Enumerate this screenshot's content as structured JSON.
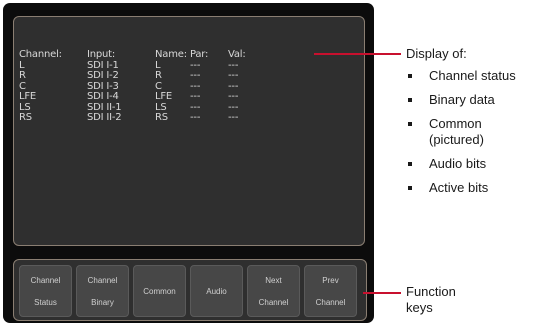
{
  "display": {
    "headers": [
      "Channel:",
      "Input:",
      "Name:",
      "Par:",
      "Val:"
    ],
    "rows": [
      [
        "L",
        "SDI I-1",
        "L",
        "---",
        "---"
      ],
      [
        "R",
        "SDI I-2",
        "R",
        "---",
        "---"
      ],
      [
        "C",
        "SDI I-3",
        "C",
        "---",
        "---"
      ],
      [
        "LFE",
        "SDI I-4",
        "LFE",
        "---",
        "---"
      ],
      [
        "LS",
        "SDI II-1",
        "LS",
        "---",
        "---"
      ],
      [
        "RS",
        "SDI II-2",
        "RS",
        "---",
        "---"
      ]
    ]
  },
  "function_keys": [
    {
      "line1": "Channel",
      "line2": "Status"
    },
    {
      "line1": "Channel",
      "line2": "Binary"
    },
    {
      "line1": "Common",
      "line2": ""
    },
    {
      "line1": "Audio",
      "line2": ""
    },
    {
      "line1": "Next",
      "line2": "Channel"
    },
    {
      "line1": "Prev",
      "line2": "Channel"
    }
  ],
  "annotations": {
    "display_title": "Display of:",
    "display_items": [
      "Channel status",
      "Binary data",
      "Common",
      "(pictured)",
      "Audio bits",
      "Active bits"
    ],
    "function_label_line1": "Function",
    "function_label_line2": "keys"
  },
  "colors": {
    "callout": "#c8102e",
    "panel": "#0c0c0c",
    "display": "#2f2f2f"
  }
}
